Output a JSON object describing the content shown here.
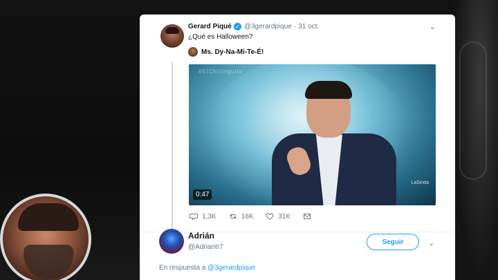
{
  "tweet": {
    "author_name": "Gerard Piqué",
    "handle": "@3gerardpique",
    "dot": "·",
    "date": "31 oct.",
    "text": "¿Qué es Halloween?",
    "quote_name": "Ms. Dy-Na-Mi-Te-É!",
    "video": {
      "banner": "#ElChiringuito",
      "duration": "0:47",
      "logo": "LaSexta"
    },
    "actions": {
      "replies": "1,3K",
      "retweets": "16K",
      "likes": "31K"
    }
  },
  "reply": {
    "name": "Adrián",
    "handle": "@Adriantr7",
    "follow_label": "Seguir",
    "in_reply_prefix": "En respuesta a",
    "in_reply_handle": "@3gerardpique"
  },
  "colors": {
    "accent": "#1da1f2",
    "text": "#14171a",
    "muted": "#657786"
  },
  "icons": {
    "verified": "verified-badge-icon",
    "menu": "chevron-down-icon",
    "reply": "reply-icon",
    "retweet": "retweet-icon",
    "like": "heart-icon",
    "dm": "envelope-icon"
  }
}
